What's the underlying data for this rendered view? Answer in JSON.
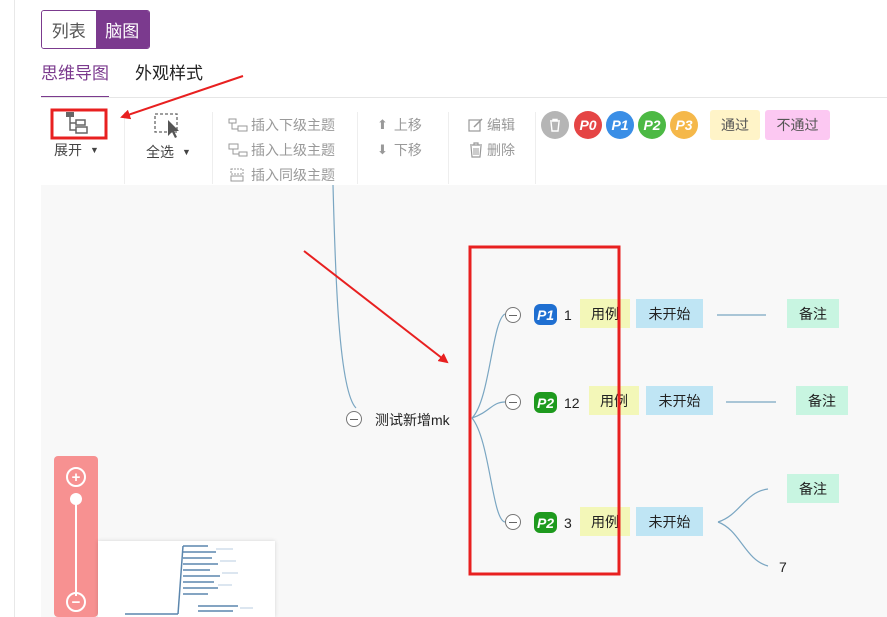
{
  "view_switch": {
    "list_label": "列表",
    "mindmap_label": "脑图"
  },
  "tabs": [
    {
      "label": "思维导图",
      "active": true
    },
    {
      "label": "外观样式",
      "active": false
    }
  ],
  "toolbar": {
    "expand_label": "展开",
    "select_all_label": "全选",
    "insert_child_label": "插入下级主题",
    "insert_parent_label": "插入上级主题",
    "insert_sibling_label": "插入同级主题",
    "move_up_label": "上移",
    "move_down_label": "下移",
    "edit_label": "编辑",
    "delete_label": "删除",
    "priority_buttons": [
      {
        "label": "P0",
        "color": "#e54545"
      },
      {
        "label": "P1",
        "color": "#3a8ee6"
      },
      {
        "label": "P2",
        "color": "#4cb944"
      },
      {
        "label": "P3",
        "color": "#f5b84a"
      }
    ],
    "pass_label": "通过",
    "fail_label": "不通过"
  },
  "mindmap": {
    "root": "测试新增mk",
    "branches": [
      {
        "priority": "P1",
        "priority_color": "#1f6fd1",
        "title": "1",
        "type_tag": "用例",
        "status_tag": "未开始",
        "notes": [
          "备注"
        ]
      },
      {
        "priority": "P2",
        "priority_color": "#1e9a1e",
        "title": "12",
        "type_tag": "用例",
        "status_tag": "未开始",
        "notes": [
          "备注"
        ]
      },
      {
        "priority": "P2",
        "priority_color": "#1e9a1e",
        "title": "3",
        "type_tag": "用例",
        "status_tag": "未开始",
        "notes": [
          "备注",
          "7"
        ]
      }
    ]
  },
  "colors": {
    "accent": "#7b3a8e",
    "annotation": "#e82020",
    "zoom_panel": "#f79191",
    "connector": "#7aa6c2"
  }
}
